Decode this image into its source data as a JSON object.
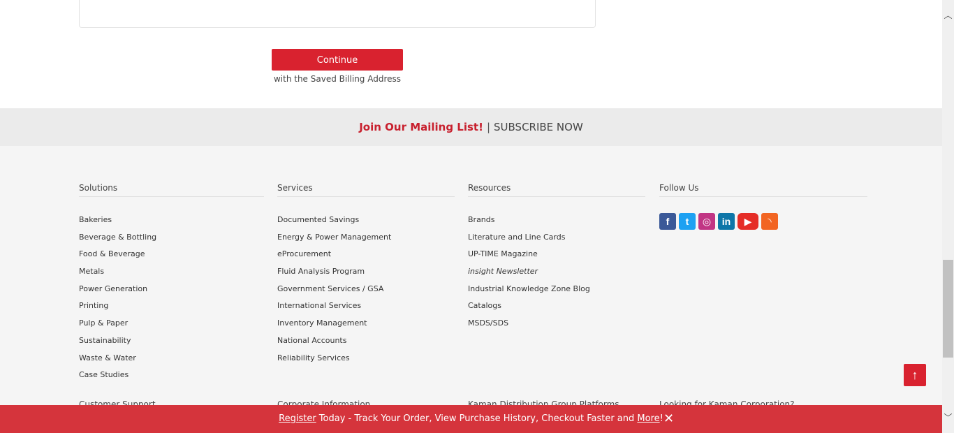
{
  "checkout": {
    "continue_label": "Continue",
    "continue_sub": "with the Saved Billing Address"
  },
  "mailing": {
    "join": "Join Our Mailing List!",
    "separator": "|",
    "subscribe": "SUBSCRIBE NOW"
  },
  "footer": {
    "solutions": {
      "title": "Solutions",
      "items": [
        "Bakeries",
        "Beverage & Bottling",
        "Food & Beverage",
        "Metals",
        "Power Generation",
        "Printing",
        "Pulp & Paper",
        "Sustainability",
        "Waste & Water",
        "Case Studies"
      ]
    },
    "services": {
      "title": "Services",
      "items": [
        "Documented Savings",
        "Energy & Power Management",
        "eProcurement",
        "Fluid Analysis Program",
        "Government Services / GSA",
        "International Services",
        "Inventory Management",
        "National Accounts",
        "Reliability Services"
      ]
    },
    "resources": {
      "title": "Resources",
      "items": [
        "Brands",
        "Literature and Line Cards",
        "UP-TIME Magazine",
        "insight Newsletter",
        "Industrial Knowledge Zone Blog",
        "Catalogs",
        "MSDS/SDS"
      ]
    },
    "follow": {
      "title": "Follow Us",
      "icons": [
        "facebook-icon",
        "twitter-icon",
        "instagram-icon",
        "linkedin-icon",
        "youtube-icon",
        "rss-icon"
      ]
    },
    "lower": {
      "customer_support": "Customer Support",
      "corporate_information": "Corporate Information",
      "platforms": "Kaman Distribution Group Platforms",
      "kaman_corp": "Looking for Kaman Corporation?"
    }
  },
  "banner": {
    "register": "Register",
    "middle": " Today - Track Your Order, View Purchase History, Checkout Faster and ",
    "more": "More",
    "end": "!",
    "close": "✕"
  },
  "colors": {
    "brand_red": "#d9222f",
    "banner_red": "#d5343c",
    "footer_bg": "#f5f5f5",
    "mailing_bg": "#ebebeb"
  }
}
